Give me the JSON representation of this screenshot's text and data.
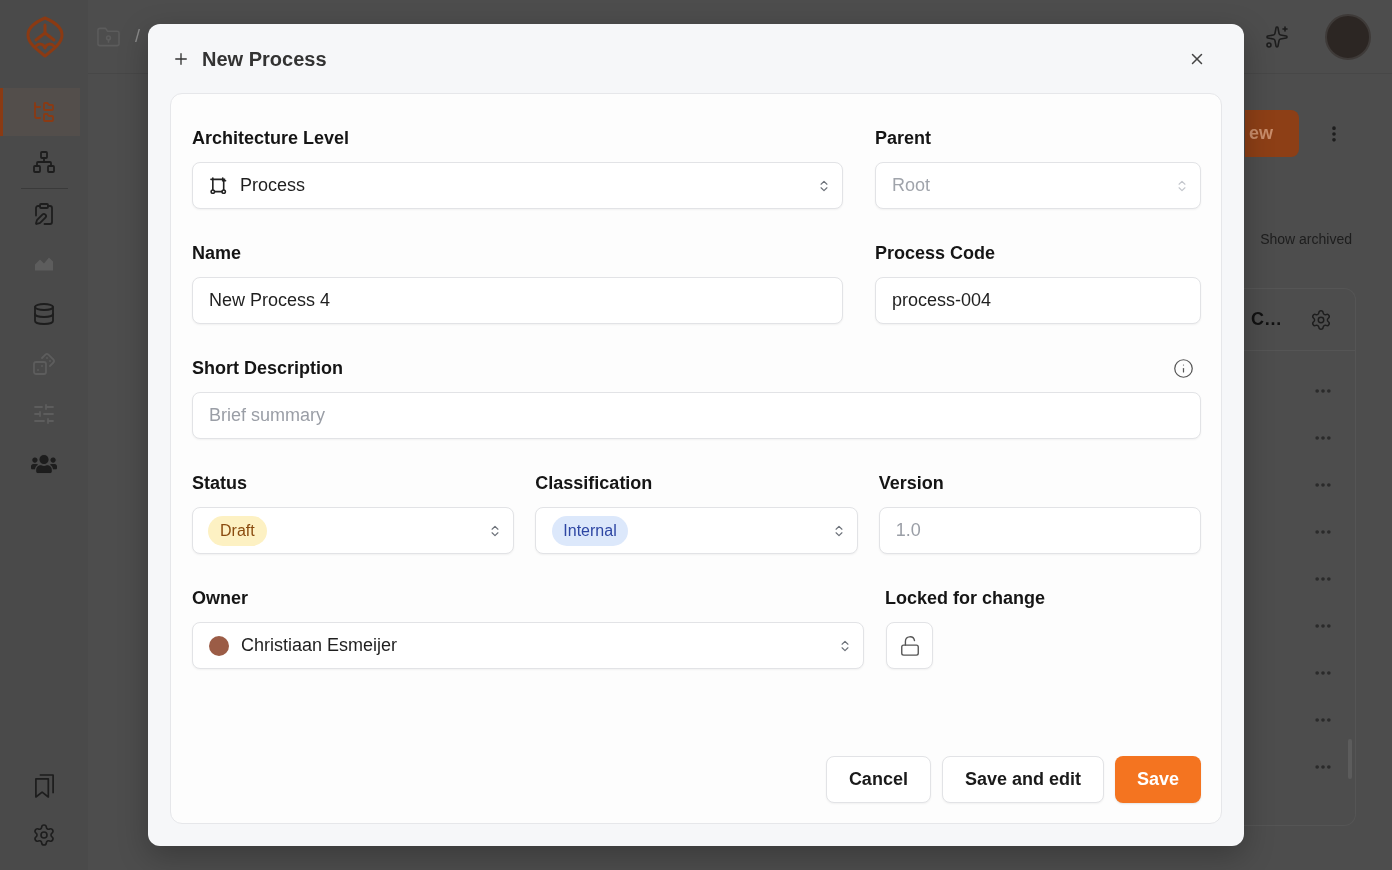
{
  "app": {
    "sidebar": {
      "items": [
        {
          "selected": true,
          "disabled": false
        },
        {
          "selected": false,
          "disabled": false
        },
        {
          "selected": false,
          "disabled": false
        },
        {
          "selected": false,
          "disabled": true
        },
        {
          "selected": false,
          "disabled": false
        },
        {
          "selected": false,
          "disabled": true
        },
        {
          "selected": false,
          "disabled": true
        },
        {
          "selected": false,
          "disabled": false
        }
      ]
    },
    "breadcrumb": {
      "separator": "/"
    },
    "toolbar": {
      "new_button": "ew",
      "show_archived": "Show archived"
    },
    "table": {
      "columns": [
        "C…"
      ]
    }
  },
  "dialog": {
    "title": "New Process",
    "architecture_level": {
      "label": "Architecture Level",
      "value": "Process"
    },
    "parent": {
      "label": "Parent",
      "value": "Root",
      "disabled": true
    },
    "name": {
      "label": "Name",
      "value": "New Process 4"
    },
    "process_code": {
      "label": "Process Code",
      "value": "process-004"
    },
    "short_description": {
      "label": "Short Description",
      "placeholder": "Brief summary"
    },
    "status": {
      "label": "Status",
      "value": "Draft"
    },
    "classification": {
      "label": "Classification",
      "value": "Internal"
    },
    "version": {
      "label": "Version",
      "placeholder": "1.0"
    },
    "owner": {
      "label": "Owner",
      "value": "Christiaan Esmeijer"
    },
    "locked_for_change": {
      "label": "Locked for change",
      "locked": false
    },
    "buttons": [
      {
        "label": "Cancel",
        "kind": "secondary"
      },
      {
        "label": "Save and edit",
        "kind": "secondary"
      },
      {
        "label": "Save",
        "kind": "primary"
      }
    ]
  }
}
